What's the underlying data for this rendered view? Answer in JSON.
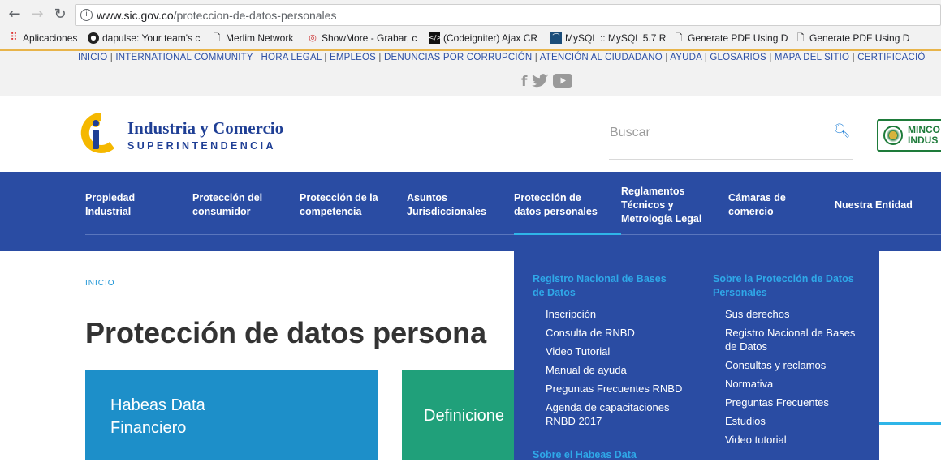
{
  "browser": {
    "url_host": "www.sic.gov.co",
    "url_path": "/proteccion-de-datos-personales",
    "bookmarks": [
      {
        "label": "Aplicaciones",
        "icon": "apps-grid-icon"
      },
      {
        "label": "dapulse: Your team's c",
        "icon": "dapulse-icon"
      },
      {
        "label": "Merlim Network",
        "icon": "page-icon"
      },
      {
        "label": "ShowMore - Grabar, c",
        "icon": "showmore-icon"
      },
      {
        "label": "(Codeigniter) Ajax CR",
        "icon": "code-icon"
      },
      {
        "label": "MySQL :: MySQL 5.7 R",
        "icon": "mysql-icon"
      },
      {
        "label": "Generate PDF Using D",
        "icon": "page-icon"
      },
      {
        "label": "Generate PDF Using D",
        "icon": "page-icon"
      }
    ]
  },
  "toplinks": [
    "INICIO",
    "INTERNATIONAL COMMUNITY",
    "HORA LEGAL",
    "EMPLEOS",
    "DENUNCIAS POR CORRUPCIÓN",
    "ATENCIÓN AL CIUDADANO",
    "AYUDA",
    "GLOSARIOS",
    "MAPA DEL SITIO",
    "CERTIFICACIÓ"
  ],
  "social": [
    "facebook-icon",
    "twitter-icon",
    "youtube-icon"
  ],
  "header": {
    "logo_title": "Industria y Comercio",
    "logo_subtitle": "SUPERINTENDENCIA",
    "search_placeholder": "Buscar",
    "mincit_line1": "MINCO",
    "mincit_line2": "INDUS"
  },
  "nav": [
    {
      "l1": "Propiedad",
      "l2": "Industrial"
    },
    {
      "l1": "Protección del",
      "l2": "consumidor"
    },
    {
      "l1": "Protección de la",
      "l2": "competencia"
    },
    {
      "l1": "Asuntos",
      "l2": "Jurisdiccionales"
    },
    {
      "l1": "Protección de",
      "l2": "datos personales"
    },
    {
      "l1": "Reglamentos",
      "l2": "Técnicos y",
      "l3": "Metrología Legal"
    },
    {
      "l1": "Cámaras de",
      "l2": "comercio"
    },
    {
      "l1": "Nuestra Entidad"
    }
  ],
  "content": {
    "breadcrumb": "INICIO",
    "title": "Protección de datos persona",
    "card1_l1": "Habeas Data",
    "card1_l2": "Financiero",
    "card2": "Definicione"
  },
  "dropdown": {
    "col1_heading_l1": "Registro Nacional de Bases",
    "col1_heading_l2": "de Datos",
    "col1_items": [
      "Inscripción",
      "Consulta de RNBD",
      "Video Tutorial",
      "Manual de ayuda",
      "Preguntas Frecuentes RNBD",
      "Agenda de capacitaciones",
      "RNBD 2017"
    ],
    "col1_heading2": "Sobre el Habeas Data",
    "col2_heading_l1": "Sobre la Protección de Datos",
    "col2_heading_l2": "Personales",
    "col2_items": [
      "Sus derechos",
      "Registro Nacional de Bases",
      "de Datos",
      "Consultas y reclamos",
      "Normativa",
      "Preguntas Frecuentes",
      "Estudios",
      "Video tutorial"
    ]
  }
}
